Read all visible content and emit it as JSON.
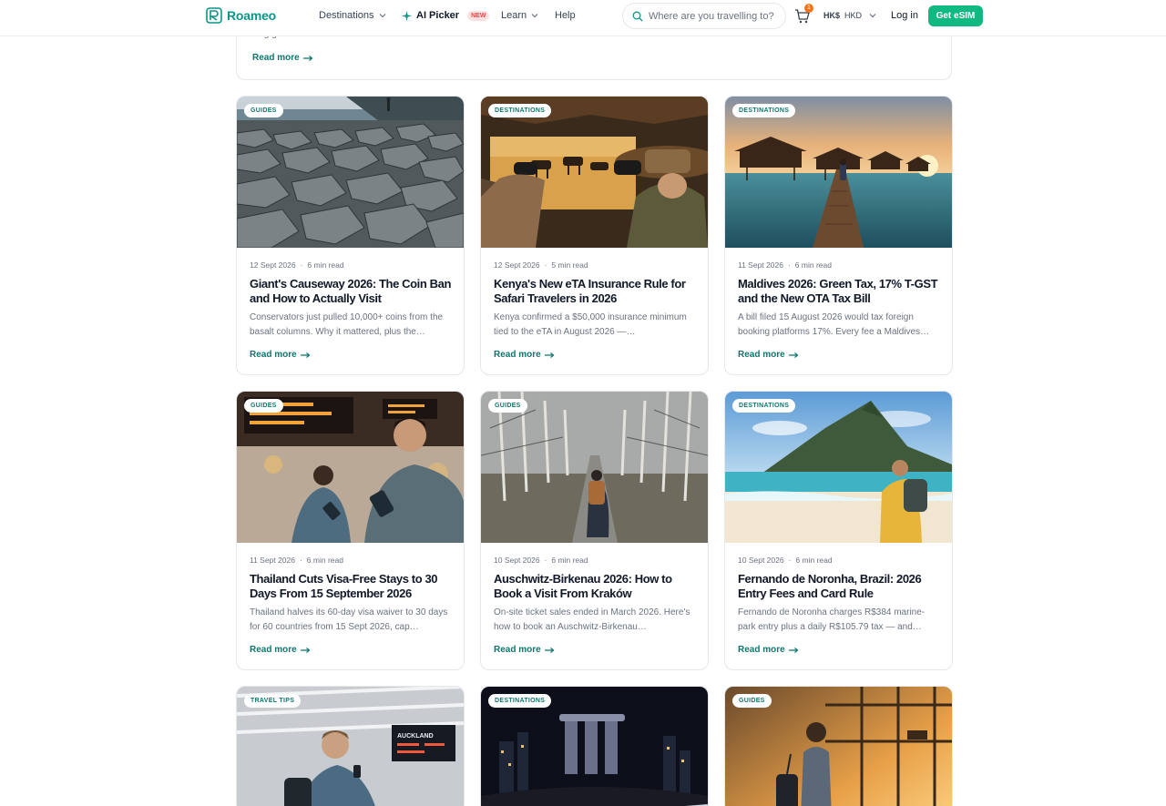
{
  "header": {
    "brand": "Roameo",
    "nav": {
      "destinations": "Destinations",
      "ai_picker": "AI Picker",
      "new_badge": "NEW",
      "learn": "Learn",
      "help": "Help"
    },
    "search_placeholder": "Where are you travelling to?",
    "cart_count": "1",
    "currency_symbol": "HK$",
    "currency_code": "HKD",
    "login": "Log in",
    "cta": "Get eSIM"
  },
  "top_card": {
    "fragment": "… g g",
    "read_more": "Read more"
  },
  "articles": [
    {
      "tag": "GUIDES",
      "date": "12 Sept 2026",
      "read_time": "6 min read",
      "title": "Giant's Causeway 2026: The Coin Ban and How to Actually Visit",
      "excerpt": "Conservators just pulled 10,000+ coins from the basalt columns. Why it mattered, plus the…",
      "read_more": "Read more"
    },
    {
      "tag": "DESTINATIONS",
      "date": "12 Sept 2026",
      "read_time": "5 min read",
      "title": "Kenya's New eTA Insurance Rule for Safari Travelers in 2026",
      "excerpt": "Kenya confirmed a $50,000 insurance minimum tied to the eTA in August 2026 —…",
      "read_more": "Read more"
    },
    {
      "tag": "DESTINATIONS",
      "date": "11 Sept 2026",
      "read_time": "6 min read",
      "title": "Maldives 2026: Green Tax, 17% T-GST and the New OTA Tax Bill",
      "excerpt": "A bill filed 15 August 2026 would tax foreign booking platforms 17%. Every fee a Maldives…",
      "read_more": "Read more"
    },
    {
      "tag": "GUIDES",
      "date": "11 Sept 2026",
      "read_time": "6 min read",
      "title": "Thailand Cuts Visa-Free Stays to 30 Days From 15 September 2026",
      "excerpt": "Thailand halves its 60-day visa waiver to 30 days for 60 countries from 15 Sept 2026, cap…",
      "read_more": "Read more"
    },
    {
      "tag": "GUIDES",
      "date": "10 Sept 2026",
      "read_time": "6 min read",
      "title": "Auschwitz-Birkenau 2026: How to Book a Visit From Kraków",
      "excerpt": "On-site ticket sales ended in March 2026. Here's how to book an Auschwitz-Birkenau…",
      "read_more": "Read more"
    },
    {
      "tag": "DESTINATIONS",
      "date": "10 Sept 2026",
      "read_time": "6 min read",
      "title": "Fernando de Noronha, Brazil: 2026 Entry Fees and Card Rule",
      "excerpt": "Fernando de Noronha charges R$384 marine-park entry plus a daily R$105.79 tax — and…",
      "read_more": "Read more"
    },
    {
      "tag": "TRAVEL TIPS"
    },
    {
      "tag": "DESTINATIONS"
    },
    {
      "tag": "GUIDES"
    }
  ],
  "image_text": {
    "board": "AUCKLAND"
  },
  "colors": {
    "brand": "#0d9488",
    "cta": "#10b981",
    "link": "#0f766e"
  }
}
